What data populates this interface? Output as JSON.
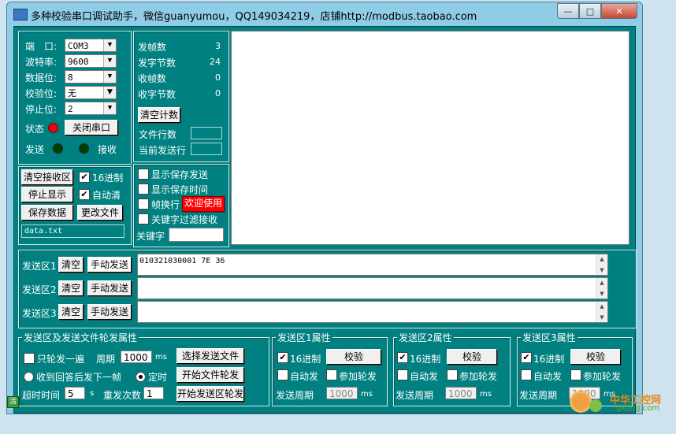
{
  "window": {
    "title": "多种校验串口调试助手，微信guanyumou，QQ149034219，店铺http://modbus.taobao.com",
    "min": "—",
    "max": "□",
    "close": "✕"
  },
  "port": {
    "port_label": "端　口:",
    "port_value": "COM3",
    "baud_label": "波特率:",
    "baud_value": "9600",
    "databits_label": "数据位:",
    "databits_value": "8",
    "parity_label": "校验位:",
    "parity_value": "无",
    "stopbits_label": "停止位:",
    "stopbits_value": "2",
    "status_label": "状态",
    "close_port_button": "关闭串口",
    "send_label": "发送",
    "receive_label": "接收"
  },
  "stats": {
    "tx_frames_label": "发帧数",
    "tx_frames": "3",
    "tx_bytes_label": "发字节数",
    "tx_bytes": "24",
    "rx_frames_label": "收帧数",
    "rx_frames": "0",
    "rx_bytes_label": "收字节数",
    "rx_bytes": "0",
    "clear_button": "清空计数",
    "file_lines_label": "文件行数",
    "current_line_label": "当前发送行"
  },
  "receive_opts": {
    "clear_rx_button": "清空接收区",
    "hex_label": "16进制",
    "stop_display_button": "停止显示",
    "auto_clear_label": "自动清",
    "save_data_button": "保存数据",
    "change_file_button": "更改文件",
    "filename": "data.txt"
  },
  "display_opts": {
    "show_save_send": "显示保存发送",
    "show_save_time": "显示保存时间",
    "frame_newline": "帧换行",
    "welcome_badge": "欢迎使用",
    "keyword_filter": "关键字过滤接收",
    "keyword_label": "关键字"
  },
  "send_areas": [
    {
      "label": "发送区1",
      "clear": "清空",
      "send": "手动发送",
      "text": "010321030001 7E 36"
    },
    {
      "label": "发送区2",
      "clear": "清空",
      "send": "手动发送",
      "text": ""
    },
    {
      "label": "发送区3",
      "clear": "清空",
      "send": "手动发送",
      "text": ""
    }
  ],
  "rotation": {
    "title": "发送区及发送文件轮发属性",
    "once_label": "只轮发一遍",
    "period_label": "周期",
    "period_value": "1000",
    "period_unit": "ms",
    "select_file_button": "选择发送文件",
    "on_reply_label": "收到回答后发下一帧",
    "timed_label": "定时",
    "start_file_button": "开始文件轮发",
    "timeout_label": "超时时间",
    "timeout_value": "5",
    "timeout_unit": "s",
    "retry_label": "重发次数",
    "retry_value": "1",
    "start_area_button": "开始发送区轮发"
  },
  "area_props": [
    {
      "title": "发送区1属性",
      "hex": "16进制",
      "check": "校验",
      "auto": "自动发",
      "join": "参加轮发",
      "period_label": "发送周期",
      "period_value": "1000",
      "unit": "ms"
    },
    {
      "title": "发送区2属性",
      "hex": "16进制",
      "check": "校验",
      "auto": "自动发",
      "join": "参加轮发",
      "period_label": "发送周期",
      "period_value": "1000",
      "unit": "ms"
    },
    {
      "title": "发送区3属性",
      "hex": "16进制",
      "check": "校验",
      "auto": "自动发",
      "join": "参加轮发",
      "period_label": "发送周期",
      "period_value": "1000",
      "unit": "ms"
    }
  ],
  "status_icon": "活",
  "watermark": {
    "line1": "中华工控网",
    "line2": "gkong.com"
  },
  "colors": {
    "led_red": "#ff0000",
    "led_green": "#004000",
    "badge_bg": "#ff0000",
    "panel": "#008080"
  }
}
